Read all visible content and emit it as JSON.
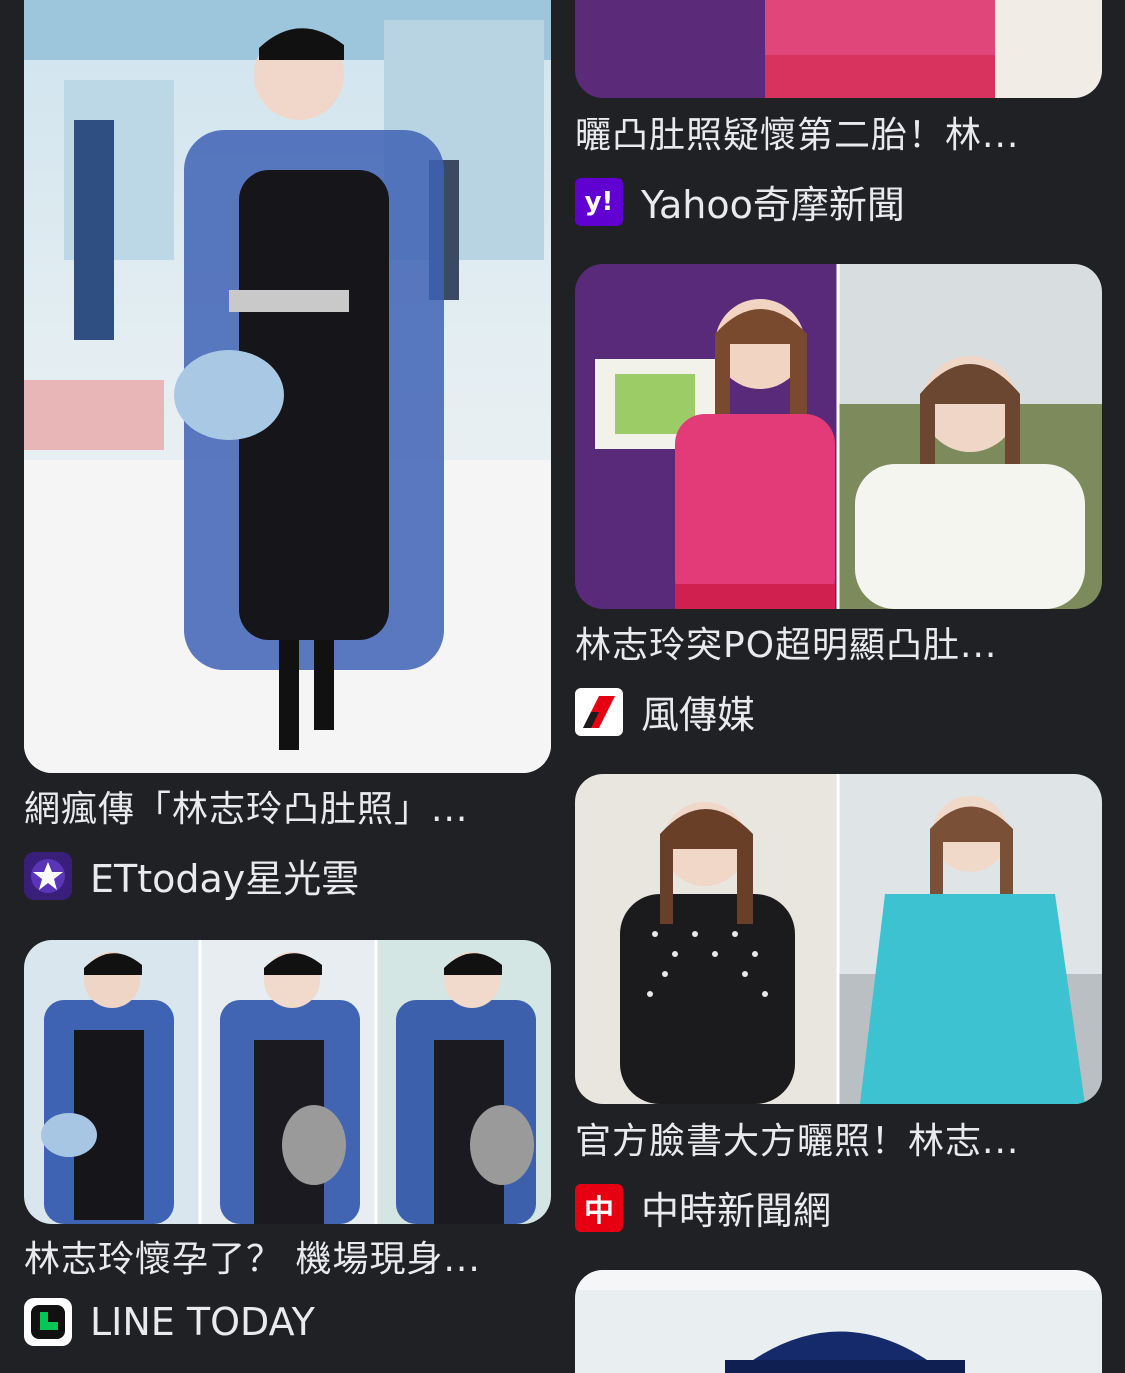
{
  "colors": {
    "background": "#202124",
    "text": "#e8eaed",
    "yahoo": "#6001d2",
    "ettoday": "#3a1f7a",
    "storm": "#ffffff",
    "chinatimes": "#e60012",
    "linetoday": "#ffffff"
  },
  "results": [
    {
      "title": "網瘋傳「林志玲凸肚照」...",
      "source": "ETtoday星光雲",
      "favicon": "ettoday-star-icon"
    },
    {
      "title": "林志玲懷孕了？ 機場現身...",
      "source": "LINE TODAY",
      "favicon": "line-today-icon"
    },
    {
      "title": "曬凸肚照疑懷第二胎！林...",
      "source": "Yahoo奇摩新聞",
      "favicon": "yahoo-icon"
    },
    {
      "title": "林志玲突PO超明顯凸肚...",
      "source": "風傳媒",
      "favicon": "storm-media-icon"
    },
    {
      "title": "官方臉書大方曬照！林志...",
      "source": "中時新聞網",
      "favicon": "china-times-icon"
    }
  ],
  "favicon_text": {
    "yahoo": "y!",
    "chinatimes": "中"
  }
}
